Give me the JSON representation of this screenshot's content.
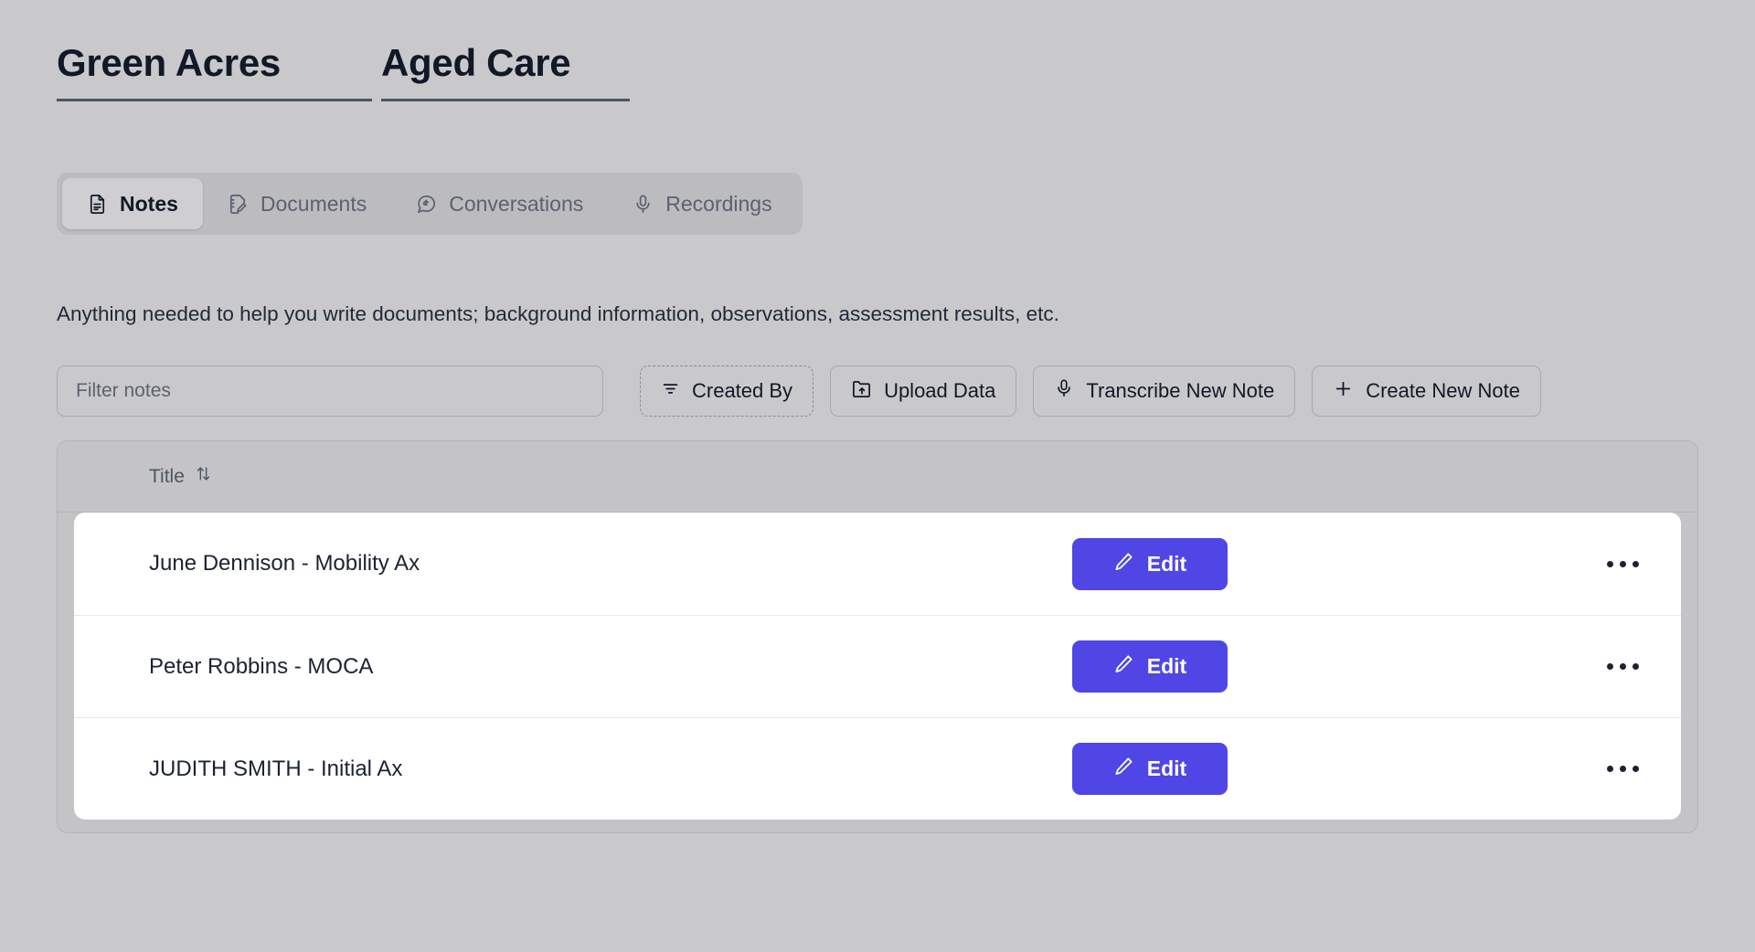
{
  "header": {
    "primary_title": "Green Acres",
    "secondary_title": "Aged Care"
  },
  "tabs": [
    {
      "label": "Notes",
      "icon": "document-text-icon",
      "active": true
    },
    {
      "label": "Documents",
      "icon": "document-edit-icon",
      "active": false
    },
    {
      "label": "Conversations",
      "icon": "chat-bubble-icon",
      "active": false
    },
    {
      "label": "Recordings",
      "icon": "microphone-icon",
      "active": false
    }
  ],
  "description": "Anything needed to help you write documents; background information, observations, assessment results, etc.",
  "toolbar": {
    "filter_placeholder": "Filter notes",
    "filter_value": "",
    "created_by_label": "Created By",
    "upload_data_label": "Upload Data",
    "transcribe_label": "Transcribe New Note",
    "create_note_label": "Create New Note"
  },
  "table": {
    "columns": [
      {
        "label": "Title",
        "sortable": true
      }
    ],
    "row_action_label": "Edit",
    "rows": [
      {
        "title": "June Dennison - Mobility Ax"
      },
      {
        "title": "Peter Robbins - MOCA"
      },
      {
        "title": "JUDITH SMITH - Initial Ax"
      }
    ]
  },
  "colors": {
    "accent": "#4f46e5",
    "page_background": "#c9c9cb",
    "row_background": "#ffffff",
    "text_primary": "#111827",
    "text_muted": "#5b6170"
  }
}
